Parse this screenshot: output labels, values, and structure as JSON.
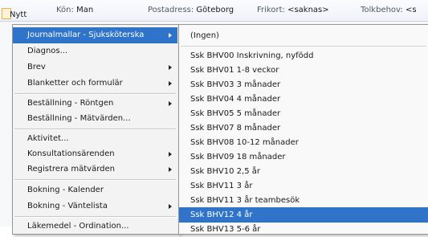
{
  "header": {
    "new_label": "Nytt",
    "fields": [
      {
        "label": "Kön:",
        "value": "Man"
      },
      {
        "label": "Postadress:",
        "value": "Göteborg"
      },
      {
        "label": "Frikort:",
        "value": "<saknas>"
      },
      {
        "label": "Tolkbehov:",
        "value": "<s"
      }
    ]
  },
  "menu": {
    "items": [
      {
        "label": "Journalmallar - Sjuksköterska",
        "submenu": true,
        "active": true
      },
      {
        "label": "Diagnos...",
        "submenu": false
      },
      {
        "label": "Brev",
        "submenu": true
      },
      {
        "label": "Blanketter och formulär",
        "submenu": true
      },
      {
        "label": "Beställning - Röntgen",
        "submenu": true
      },
      {
        "label": "Beställning - Mätvärden...",
        "submenu": false
      },
      {
        "label": "Aktivitet...",
        "submenu": false
      },
      {
        "label": "Konsultationsärenden",
        "submenu": true
      },
      {
        "label": "Registrera mätvärden",
        "submenu": true
      },
      {
        "label": "Bokning - Kalender",
        "submenu": false
      },
      {
        "label": "Bokning - Väntelista",
        "submenu": true
      },
      {
        "label": "Läkemedel - Ordination...",
        "submenu": false
      }
    ]
  },
  "submenu": {
    "items": [
      {
        "label": "(Ingen)"
      },
      {
        "label": "Ssk BHV00 Inskrivning, nyfödd"
      },
      {
        "label": "Ssk BHV01 1-8 veckor"
      },
      {
        "label": "Ssk BHV03 3 månader"
      },
      {
        "label": "Ssk BHV04 4 månader"
      },
      {
        "label": "Ssk BHV05 5 månader"
      },
      {
        "label": "Ssk BHV07 8 månader"
      },
      {
        "label": "Ssk BHV08 10-12 månader"
      },
      {
        "label": "Ssk BHV09 18 månader"
      },
      {
        "label": "Ssk BHV10 2,5 år"
      },
      {
        "label": "Ssk BHV11 3 år"
      },
      {
        "label": "Ssk BHV11 3 år teambesök"
      },
      {
        "label": "Ssk BHV12 4 år",
        "selected": true
      },
      {
        "label": "Ssk BHV13 5-6 år"
      }
    ]
  },
  "colors": {
    "highlight": "#2f74c8",
    "menu_bg": "#f3f3f3",
    "infobar_bg": "#eef2f8"
  }
}
